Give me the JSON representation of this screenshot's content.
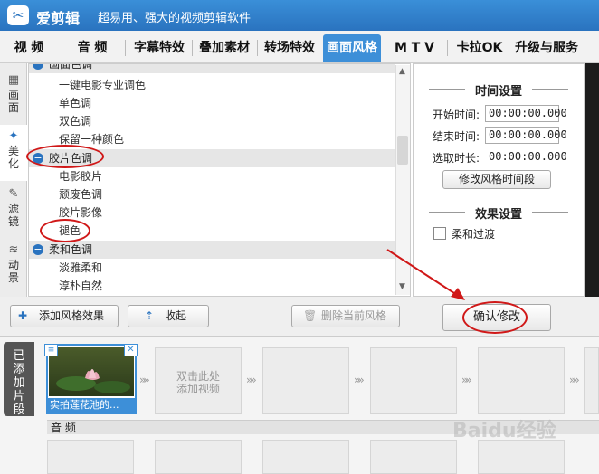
{
  "app": {
    "logo_char": "✂",
    "name": "爱剪辑",
    "slogan": "超易用、强大的视频剪辑软件"
  },
  "tabs": [
    {
      "label": "视  频"
    },
    {
      "label": "音  频"
    },
    {
      "label": "字幕特效"
    },
    {
      "label": "叠加素材"
    },
    {
      "label": "转场特效"
    },
    {
      "label": "画面风格",
      "active": true
    },
    {
      "label": "M T V"
    },
    {
      "label": "卡拉OK"
    },
    {
      "label": "升级与服务"
    }
  ],
  "left_tabs": [
    {
      "label": "画\n面",
      "icon": "film-icon"
    },
    {
      "label": "美\n化",
      "icon": "sparkle-icon",
      "active": true
    },
    {
      "label": "滤\n镜",
      "icon": "wand-icon"
    },
    {
      "label": "动\n景",
      "icon": "wave-icon"
    }
  ],
  "style_list": {
    "group0": "画面色调",
    "items0": [
      "一键电影专业调色",
      "单色调",
      "双色调",
      "保留一种颜色"
    ],
    "group1": "胶片色调",
    "items1": [
      "电影胶片",
      "颓废色调",
      "胶片影像",
      "褪色"
    ],
    "group2": "柔和色调",
    "items2": [
      "淡雅柔和",
      "淳朴自然"
    ]
  },
  "time_settings": {
    "heading": "时间设置",
    "start_label": "开始时间:",
    "start_value": "00:00:00.000",
    "end_label": "结束时间:",
    "end_value": "00:00:00.000",
    "duration_label": "选取时长:",
    "duration_value": "00:00:00.000",
    "modify_button": "修改风格时间段"
  },
  "effect_settings": {
    "heading": "效果设置",
    "fade_label": "柔和过渡",
    "fade_checked": false
  },
  "toolbar": {
    "add_style": "添加风格效果",
    "collapse": "收起",
    "delete_current": "删除当前风格",
    "confirm": "确认修改"
  },
  "clips": {
    "added_tab": "已\n添\n加\n片\n段",
    "clip1_label": "实拍莲花池的...",
    "placeholder": "双击此处\n添加视频",
    "audio_label": "音 频"
  },
  "watermark": "Baidu经验",
  "colors": {
    "accent": "#3d8fd8",
    "annotation_red": "#d01818"
  }
}
